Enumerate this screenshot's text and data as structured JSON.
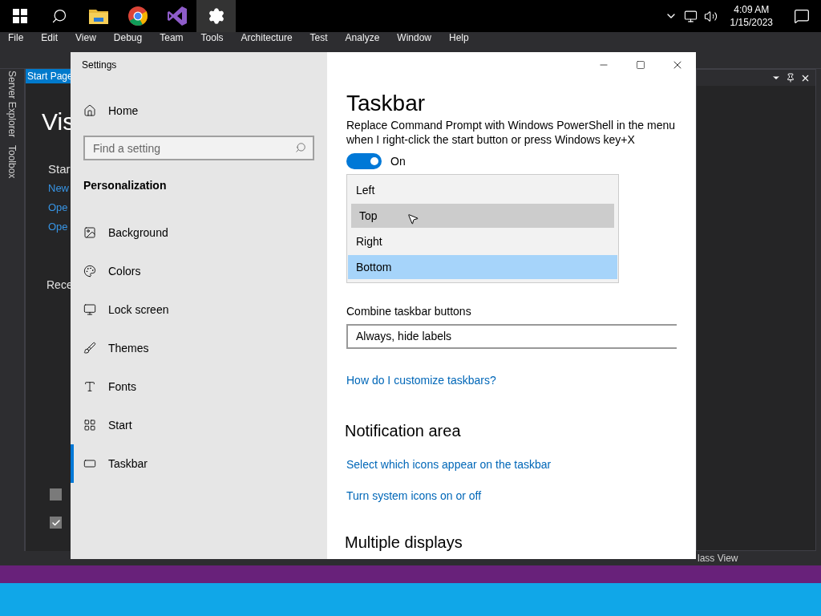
{
  "os_taskbar": {
    "apps": [
      {
        "kind": "start",
        "selected": false
      },
      {
        "kind": "search",
        "selected": false
      },
      {
        "kind": "folder",
        "selected": false
      },
      {
        "kind": "browser",
        "selected": false
      },
      {
        "kind": "ide",
        "selected": false
      },
      {
        "kind": "settings",
        "selected": true
      }
    ],
    "time": "4:09 AM",
    "date": "1/15/2023"
  },
  "ide": {
    "menu": [
      "File",
      "Edit",
      "View",
      "Debug",
      "Team",
      "Tools",
      "Architecture",
      "Test",
      "Analyze",
      "Window",
      "Help"
    ],
    "side_tabs": [
      "Server Explorer",
      "Toolbox"
    ],
    "doc_tab": "Start Page",
    "start_page": {
      "title": "Vis",
      "section": "Star",
      "links": [
        "New",
        "Ope",
        "Ope"
      ],
      "recent": "Rece"
    },
    "checkboxes": [
      {
        "checked": false
      },
      {
        "checked": true
      }
    ],
    "bottom_tab": "lass View"
  },
  "settings": {
    "title": "Settings",
    "home": "Home",
    "search": {
      "placeholder": "Find a setting"
    },
    "category": "Personalization",
    "nav": [
      {
        "label": "Background",
        "selected": false
      },
      {
        "label": "Colors",
        "selected": false
      },
      {
        "label": "Lock screen",
        "selected": false
      },
      {
        "label": "Themes",
        "selected": false
      },
      {
        "label": "Fonts",
        "selected": false
      },
      {
        "label": "Start",
        "selected": false
      },
      {
        "label": "Taskbar",
        "selected": true
      }
    ],
    "page": {
      "title": "Taskbar",
      "description": "Replace Command Prompt with Windows PowerShell in the menu when I right-click the start button or press Windows key+X",
      "toggle": {
        "on": true,
        "label": "On"
      },
      "position_list": [
        {
          "label": "Left",
          "hovered": false,
          "selected": false
        },
        {
          "label": "Top",
          "hovered": true,
          "selected": false
        },
        {
          "label": "Right",
          "hovered": false,
          "selected": false
        },
        {
          "label": "Bottom",
          "hovered": false,
          "selected": true
        }
      ],
      "combine": {
        "label": "Combine taskbar buttons",
        "value": "Always, hide labels"
      },
      "help_link": "How do I customize taskbars?",
      "notification": {
        "heading": "Notification area",
        "links": [
          "Select which icons appear on the taskbar",
          "Turn system icons on or off"
        ]
      },
      "next_heading": "Multiple displays"
    }
  }
}
